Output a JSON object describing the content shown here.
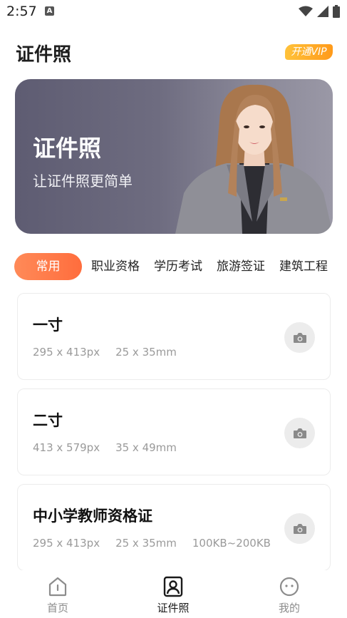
{
  "status_bar": {
    "time": "2:57",
    "notification_letter": "A"
  },
  "header": {
    "title": "证件照",
    "vip_label": "开通VIP"
  },
  "banner": {
    "title": "证件照",
    "subtitle": "让证件照更简单"
  },
  "tabs": [
    {
      "label": "常用",
      "active": true
    },
    {
      "label": "职业资格",
      "active": false
    },
    {
      "label": "学历考试",
      "active": false
    },
    {
      "label": "旅游签证",
      "active": false
    },
    {
      "label": "建筑工程",
      "active": false
    }
  ],
  "cards": [
    {
      "title": "一寸",
      "pixels": "295 x 413px",
      "size": "25 x 35mm",
      "file_size": ""
    },
    {
      "title": "二寸",
      "pixels": "413 x 579px",
      "size": "35 x 49mm",
      "file_size": ""
    },
    {
      "title": "中小学教师资格证",
      "pixels": "295 x 413px",
      "size": "25 x 35mm",
      "file_size": "100KB~200KB"
    }
  ],
  "bottom_nav": [
    {
      "label": "首页",
      "icon": "home-icon",
      "active": false
    },
    {
      "label": "证件照",
      "icon": "id-photo-icon",
      "active": true
    },
    {
      "label": "我的",
      "icon": "profile-face-icon",
      "active": false
    }
  ],
  "colors": {
    "accent": "#ff7a45",
    "vip": "#ffb02e",
    "banner": "#6e6c80"
  }
}
